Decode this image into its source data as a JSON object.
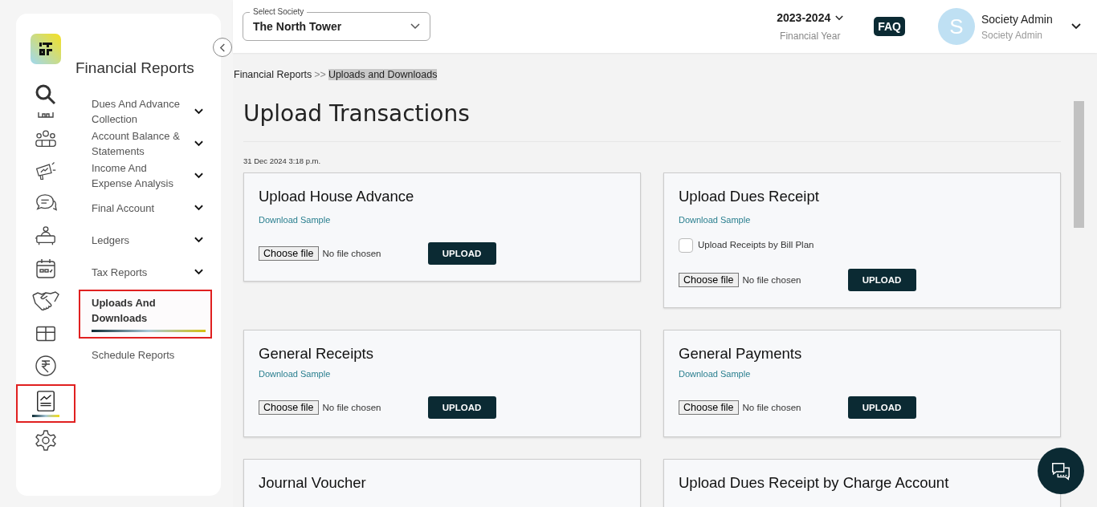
{
  "rail": [
    {
      "kind": "search",
      "selected": false
    },
    {
      "kind": "building",
      "selected": false
    },
    {
      "kind": "people",
      "selected": false
    },
    {
      "kind": "megaphone",
      "selected": false
    },
    {
      "kind": "chat",
      "selected": false
    },
    {
      "kind": "desk",
      "selected": false
    },
    {
      "kind": "calendar",
      "selected": false
    },
    {
      "kind": "handshake",
      "selected": false
    },
    {
      "kind": "box",
      "selected": false
    },
    {
      "kind": "rupee",
      "selected": false
    },
    {
      "kind": "report",
      "selected": true
    },
    {
      "kind": "gear",
      "selected": false
    }
  ],
  "submenu": {
    "title": "Financial Reports",
    "items": [
      {
        "label": "Dues And Advance Collection",
        "expandable": true,
        "selected": false
      },
      {
        "label": "Account Balance & Statements",
        "expandable": true,
        "selected": false
      },
      {
        "label": "Income And Expense Analysis",
        "expandable": true,
        "selected": false
      },
      {
        "label": "Final Account",
        "expandable": true,
        "selected": false
      },
      {
        "label": "Ledgers",
        "expandable": true,
        "selected": false
      },
      {
        "label": "Tax Reports",
        "expandable": true,
        "selected": false
      },
      {
        "label": "Uploads And Downloads",
        "expandable": false,
        "selected": true
      },
      {
        "label": "Schedule Reports",
        "expandable": false,
        "selected": false
      }
    ]
  },
  "header": {
    "society": {
      "label": "Select Society",
      "value": "The North Tower"
    },
    "year": "2023-2024",
    "year_caption": "Financial Year",
    "faq": "FAQ",
    "user": {
      "initial": "S",
      "name": "Society Admin",
      "role": "Society Admin"
    }
  },
  "breadcrumb": [
    {
      "label": "Financial Reports",
      "selected": false
    },
    {
      "label": "Uploads and Downloads",
      "selected": true
    }
  ],
  "breadcrumb_separator": ">>",
  "page_title": "Upload Transactions",
  "timestamp": "31 Dec 2024 3:18 p.m.",
  "cards": [
    {
      "title": "Upload House Advance",
      "link": "Download Sample",
      "file_button": "Choose file",
      "file_status": "No file chosen",
      "button": "UPLOAD"
    },
    {
      "title": "Upload Dues Receipt",
      "link": "Download Sample",
      "checkbox": {
        "label": "Upload Receipts by Bill Plan",
        "checked": false
      },
      "file_button": "Choose file",
      "file_status": "No file chosen",
      "button": "UPLOAD"
    },
    {
      "title": "General Receipts",
      "link": "Download Sample",
      "file_button": "Choose file",
      "file_status": "No file chosen",
      "button": "UPLOAD"
    },
    {
      "title": "General Payments",
      "link": "Download Sample",
      "file_button": "Choose file",
      "file_status": "No file chosen",
      "button": "UPLOAD"
    },
    {
      "title": "Journal Voucher"
    },
    {
      "title": "Upload Dues Receipt by Charge Account"
    }
  ]
}
